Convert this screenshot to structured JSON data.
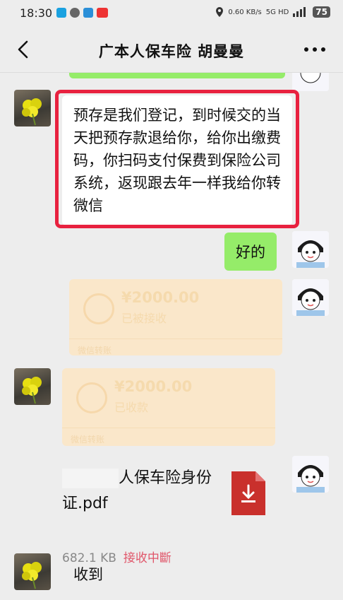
{
  "status_bar": {
    "time": "18:30",
    "network_speed": "0.60 KB/s",
    "network_type": "5G HD",
    "battery": "75"
  },
  "header": {
    "title": "广本人保车险 胡曼曼",
    "back_icon": "chevron-left-icon",
    "more_icon": "more-dots-icon"
  },
  "messages": {
    "received_text_1": "预存是我们登记，到时候交的当天把预存款退给你，给你出缴费码，你扫码支付保费到保险公司系统，返现跟去年一样我给你转微信",
    "sent_text_1": "好的",
    "transfer_sent": {
      "amount": "¥2000.00",
      "status": "已被接收",
      "footer": "微信转账"
    },
    "transfer_received": {
      "amount": "¥2000.00",
      "status": "已收款",
      "footer": "微信转账"
    },
    "file": {
      "name": "人保车险身份证.pdf",
      "name_line1": "人保车险身份",
      "name_line2": "证.pdf",
      "size": "682.1 KB",
      "status": "接收中斷"
    },
    "received_text_2": "收到"
  },
  "colors": {
    "highlight_frame": "#e8213f",
    "sent_bubble": "#95ec69",
    "transfer_bg": "#fbe7c9"
  }
}
